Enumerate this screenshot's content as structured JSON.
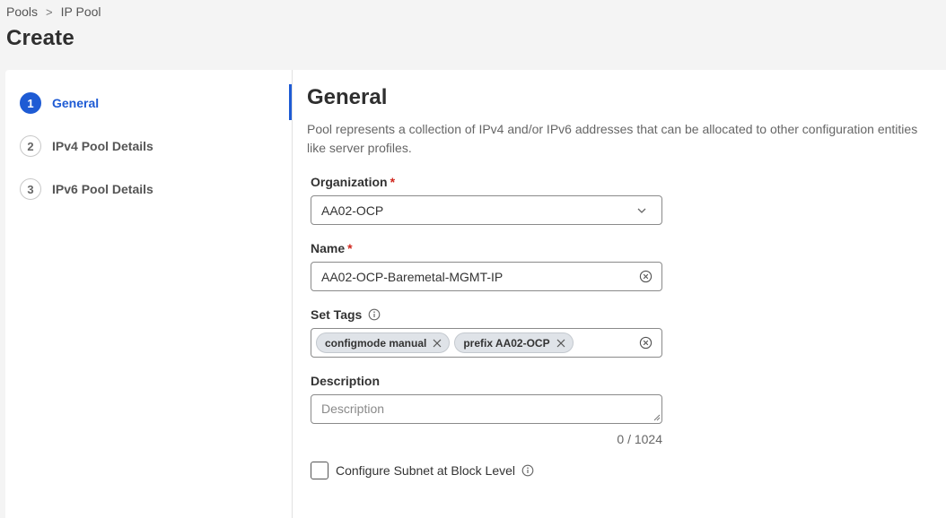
{
  "breadcrumb": {
    "items": [
      "Pools",
      "IP Pool"
    ],
    "separator": ">"
  },
  "page": {
    "title": "Create"
  },
  "steps": [
    {
      "number": "1",
      "label": "General",
      "active": true
    },
    {
      "number": "2",
      "label": "IPv4 Pool Details",
      "active": false
    },
    {
      "number": "3",
      "label": "IPv6 Pool Details",
      "active": false
    }
  ],
  "section": {
    "title": "General",
    "description": "Pool represents a collection of IPv4 and/or IPv6 addresses that can be allocated to other configuration entities like server profiles."
  },
  "form": {
    "organization": {
      "label": "Organization",
      "required_mark": "*",
      "value": "AA02-OCP"
    },
    "name": {
      "label": "Name",
      "required_mark": "*",
      "value": "AA02-OCP-Baremetal-MGMT-IP"
    },
    "tags": {
      "label": "Set Tags",
      "items": [
        "configmode manual",
        "prefix AA02-OCP"
      ]
    },
    "description": {
      "label": "Description",
      "placeholder": "Description",
      "counter": "0 / 1024"
    },
    "subnet_checkbox": {
      "label": "Configure Subnet at Block Level",
      "checked": false
    }
  },
  "colors": {
    "accent": "#1e5bd4",
    "required": "#d0271d",
    "background": "#f4f4f4"
  },
  "icons": {
    "breadcrumb_separator": "chevron-right-icon",
    "dropdown": "chevron-down-icon",
    "clear": "clear-circle-icon",
    "tag_remove": "close-icon",
    "info": "info-icon"
  }
}
